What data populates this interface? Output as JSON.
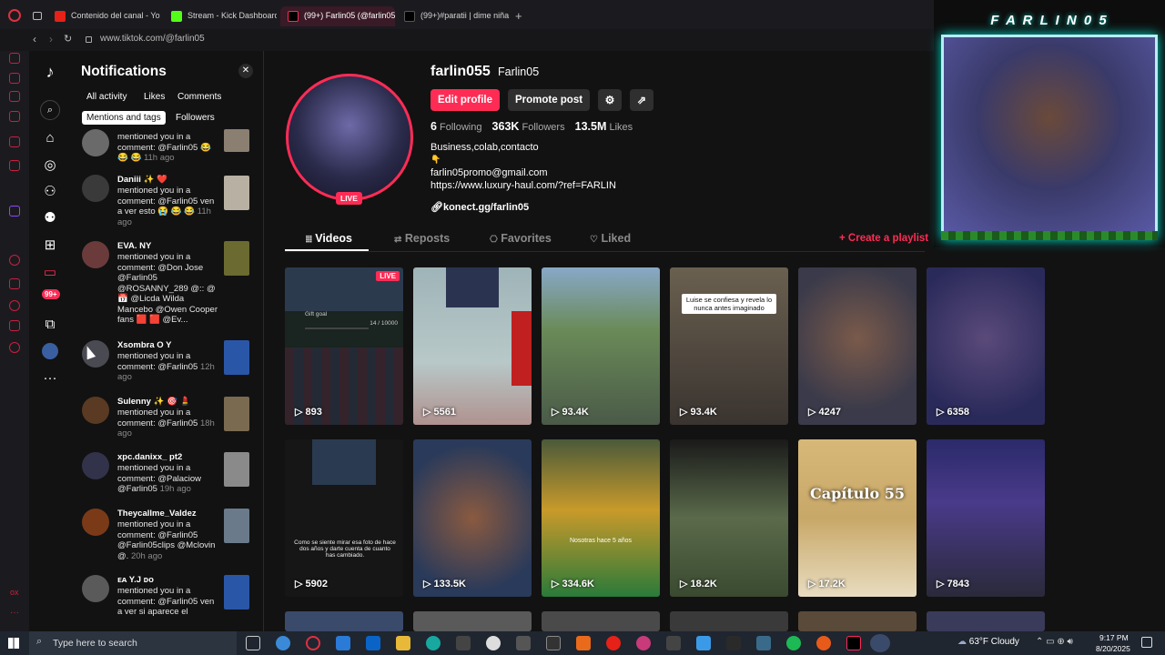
{
  "browser": {
    "tabs": [
      {
        "title": "Contenido del canal - You",
        "active": false
      },
      {
        "title": "Stream - Kick Dashboard",
        "active": false
      },
      {
        "title": "(99+) Farlin05 (@farlin05)",
        "active": true
      },
      {
        "title": "(99+)#paratii | dime niña",
        "active": false
      }
    ],
    "new_tab_icon": "plus-icon",
    "url": "www.tiktok.com/@farlin05"
  },
  "opera_sidebar": {
    "badge": "99+"
  },
  "tiktok_nav": {
    "icons": [
      "tiktok-logo-icon",
      "search-icon",
      "home-icon",
      "explore-icon",
      "following-icon",
      "friends-icon",
      "upload-icon",
      "messages-icon",
      "inbox-icon",
      "live-studio-icon",
      "avatar",
      "more-icon"
    ],
    "inbox_badge": "99+"
  },
  "notifications": {
    "title": "Notifications",
    "filters": [
      "All activity",
      "Likes",
      "Comments",
      "Mentions and tags",
      "Followers"
    ],
    "selected_filter": "Mentions and tags",
    "items": [
      {
        "user": "",
        "text": "mentioned you in a comment: @Farlin05 😂 😂 😂",
        "time": "11h ago"
      },
      {
        "user": "Daniii ✨ ❤️",
        "text": "mentioned you in a comment: @Farlin05 ven a ver esto 😭 😂 😂",
        "time": "11h ago"
      },
      {
        "user": "EVA. NY",
        "text": "mentioned you in a comment: @Don Jose @Farlin05 @ROSANNY_289 @:: @ 📅 @Licda Wilda Mancebo @Owen Cooper fans 🟥 🟥 @Ev...",
        "time": ""
      },
      {
        "user": "Xsombra O Y",
        "text": "mentioned you in a comment: @Farlin05",
        "time": "12h ago"
      },
      {
        "user": "Sulenny ✨ 🎯 💄",
        "text": "mentioned you in a comment: @Farlin05",
        "time": "18h ago"
      },
      {
        "user": "xpc.danixx_ pt2",
        "text": "mentioned you in a comment: @Palaciow @Farlin05",
        "time": "19h ago"
      },
      {
        "user": "Theycallme_Valdez",
        "text": "mentioned you in a comment: @Farlin05 @Farlin05clips @Mclovin @.",
        "time": "20h ago"
      },
      {
        "user": "ᴇᴀ Y.J ᴅᴏ",
        "text": "mentioned you in a comment: @Farlin05 ven a ver si aparece el",
        "time": ""
      }
    ]
  },
  "profile": {
    "username": "farlin055",
    "nickname": "Farlin05",
    "live_badge": "LIVE",
    "edit_button": "Edit profile",
    "promote_button": "Promote post",
    "stats": {
      "following_count": "6",
      "following_label": "Following",
      "followers_count": "363K",
      "followers_label": "Followers",
      "likes_count": "13.5M",
      "likes_label": "Likes"
    },
    "bio_line1": "Business,colab,contacto",
    "bio_line2": "👇",
    "email": "farlin05promo@gmail.com",
    "bio_link": "https://www.luxury-haul.com/?ref=FARLIN",
    "link": "konect.gg/farlin05"
  },
  "video_tabs": {
    "tabs": [
      "Videos",
      "Reposts",
      "Favorites",
      "Liked"
    ],
    "active": "Videos",
    "create_playlist": "+ Create a playlist"
  },
  "videos": [
    {
      "views": "893",
      "live_label": "LIVE",
      "goal_label": "Gift goal",
      "goal_value": "14 / 10000"
    },
    {
      "views": "5561"
    },
    {
      "views": "93.4K",
      "caption": "Luise se confiesa y revela lo nunca antes imaginado"
    },
    {
      "views": "4247"
    },
    {
      "views": "6358"
    },
    {
      "views": "5902",
      "caption": "Como se siente mirar esa foto de hace dos años y darte cuenta de cuanto has cambiado."
    },
    {
      "views": "133.5K"
    },
    {
      "views": "334.6K",
      "caption": "Nosotras hace 5 años"
    },
    {
      "views": "18.2K"
    },
    {
      "views": "17.2K",
      "caption": "Capítulo 55"
    },
    {
      "views": "7843"
    }
  ],
  "overlay": {
    "brand_text": "F A R L I N 0 5"
  },
  "taskbar": {
    "search_placeholder": "Type here to search",
    "weather": "63°F  Cloudy",
    "time": "9:17 PM",
    "date": "8/20/2025"
  },
  "colors": {
    "accent": "#fe2c55",
    "link": "#fe2c55",
    "bg": "#121212",
    "teal": "#00e0d0"
  }
}
